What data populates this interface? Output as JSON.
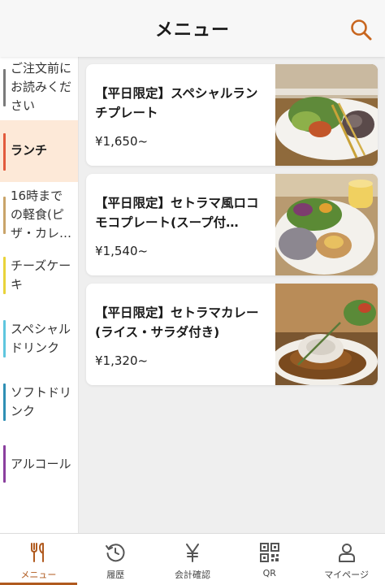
{
  "header": {
    "title": "メニュー",
    "search_icon": "search-icon"
  },
  "colors": {
    "accent": "#b05a1e",
    "active_category_bg": "#fde9d8",
    "search_icon": "#c8661f"
  },
  "sidebar": {
    "items": [
      {
        "label": "ご注文前にお読みください",
        "lines": [
          "ご注文前に",
          "お読みくだ",
          "さい"
        ],
        "color": "#7a7a7a",
        "active": false
      },
      {
        "label": "ランチ",
        "lines": [
          "ランチ"
        ],
        "color": "#e25a3c",
        "active": true
      },
      {
        "label": "16時までの軽食(ピザ・カレ…",
        "lines": [
          "16時まで",
          "の軽食(ピ",
          "ザ・カレ…"
        ],
        "color": "#c9a46a",
        "active": false
      },
      {
        "label": "チーズケーキ",
        "lines": [
          "チーズケー",
          "キ"
        ],
        "color": "#e9d33a",
        "active": false
      },
      {
        "label": "スペシャルドリンク",
        "lines": [
          "スペシャル",
          "ドリンク"
        ],
        "color": "#5fc6de",
        "active": false
      },
      {
        "label": "ソフトドリンク",
        "lines": [
          "ソフトドリ",
          "ンク"
        ],
        "color": "#2f8fb4",
        "active": false
      },
      {
        "label": "アルコール",
        "lines": [
          "アルコール"
        ],
        "color": "#8a3f9e",
        "active": false
      }
    ]
  },
  "menu": {
    "items": [
      {
        "title": "【平日限定】スペシャルランチプレート",
        "price": "¥1,650~",
        "image": "plate-salad-onigiri-photo"
      },
      {
        "title": "【平日限定】セトラマ風ロコモコプレート(スープ付…",
        "price": "¥1,540~",
        "image": "locomoco-plate-photo"
      },
      {
        "title": "【平日限定】セトラマカレー(ライス・サラダ付き)",
        "price": "¥1,320~",
        "image": "curry-plate-photo"
      }
    ]
  },
  "tabbar": {
    "tabs": [
      {
        "label": "メニュー",
        "icon": "fork-knife-icon",
        "active": true
      },
      {
        "label": "履歴",
        "icon": "history-icon",
        "active": false
      },
      {
        "label": "会計確認",
        "icon": "yen-icon",
        "active": false
      },
      {
        "label": "QR",
        "icon": "qr-code-icon",
        "active": false
      },
      {
        "label": "マイページ",
        "icon": "user-icon",
        "active": false
      }
    ]
  }
}
